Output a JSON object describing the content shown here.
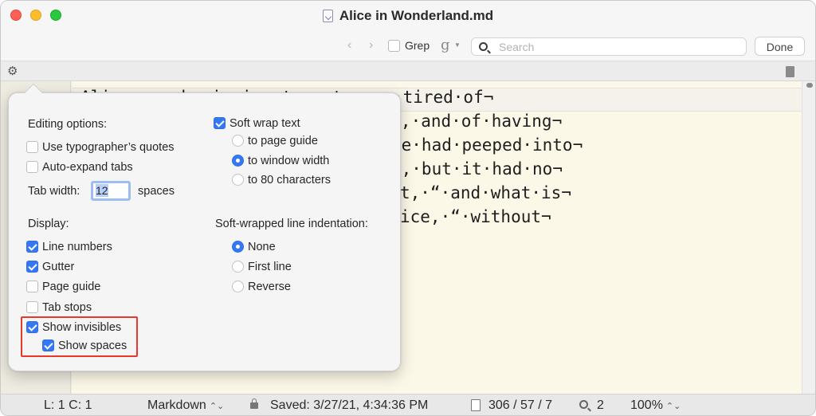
{
  "window": {
    "title": "Alice in Wonderland.md"
  },
  "searchbar": {
    "back_arrow": "‹",
    "forward_arrow": "›",
    "grep_label": "Grep",
    "grep_checked": false,
    "g_menu": "g",
    "search_placeholder": "Search",
    "done_label": "Done"
  },
  "editor": {
    "lines": [
      "Alice·was·beginning·to·get·very·tired·of¬",
      "ank,·and·of·having¬",
      "he·had·peeped·into¬",
      "g,·but·it·had·no¬",
      "t,·“·and·what·is¬",
      "ice,·“·without¬"
    ]
  },
  "popover": {
    "editing_heading": "Editing options:",
    "typographer_label": "Use typographer’s quotes",
    "typographer_checked": false,
    "autoexpand_label": "Auto-expand tabs",
    "autoexpand_checked": false,
    "tab_width_label": "Tab width:",
    "tab_width_value": "12",
    "spaces_label": "spaces",
    "display_heading": "Display:",
    "display_items": [
      {
        "label": "Line numbers",
        "checked": true
      },
      {
        "label": "Gutter",
        "checked": true
      },
      {
        "label": "Page guide",
        "checked": false
      },
      {
        "label": "Tab stops",
        "checked": false
      },
      {
        "label": "Show invisibles",
        "checked": true
      },
      {
        "label": "Show spaces",
        "checked": true
      }
    ],
    "soft_wrap_label": "Soft wrap text",
    "soft_wrap_checked": true,
    "wrap_options": [
      {
        "label": "to page guide",
        "selected": false
      },
      {
        "label": "to window width",
        "selected": true
      },
      {
        "label": "to 80 characters",
        "selected": false
      }
    ],
    "indent_heading": "Soft-wrapped line indentation:",
    "indent_options": [
      {
        "label": "None",
        "selected": true
      },
      {
        "label": "First line",
        "selected": false
      },
      {
        "label": "Reverse",
        "selected": false
      }
    ]
  },
  "status": {
    "position": "L: 1 C: 1",
    "language": "Markdown",
    "updown_glyph": "⌃⌄",
    "saved": "Saved: 3/27/21, 4:34:36 PM",
    "counts": "306 / 57 / 7",
    "matches": "2",
    "zoom": "100%"
  },
  "colors": {
    "accent": "#3478f6",
    "highlight_border": "#e8372b",
    "editor_bg": "#fcf8e8"
  },
  "icons": {
    "settings": "gear-icon",
    "search": "search-icon",
    "document": "document-icon",
    "lock": "lock-icon",
    "counts": "page-icon",
    "find": "magnifier-icon"
  }
}
